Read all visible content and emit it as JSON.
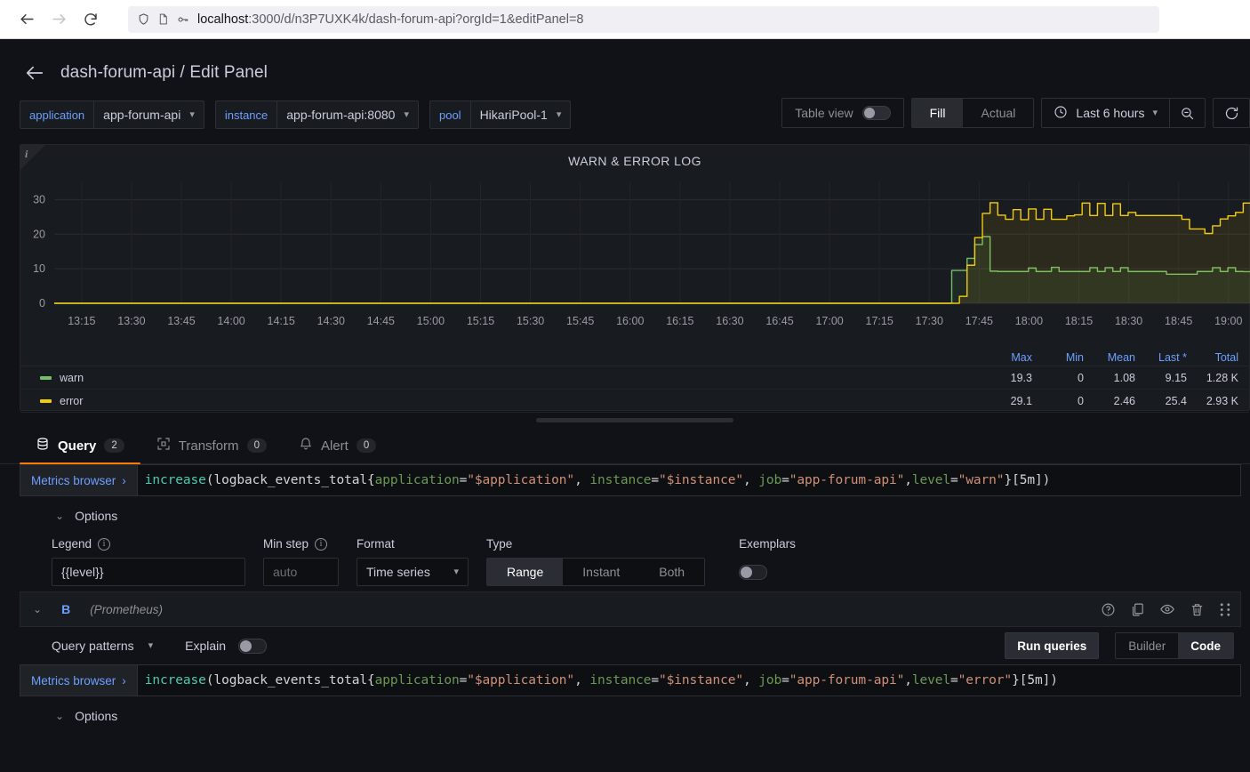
{
  "browser": {
    "url_host": "localhost",
    "url_rest": ":3000/d/n3P7UXK4k/dash-forum-api?orgId=1&editPanel=8",
    "back_icon": "back-arrow-icon",
    "forward_icon": "forward-arrow-icon",
    "reload_icon": "reload-icon",
    "shield_icon": "shield-icon",
    "page_icon": "page-icon",
    "key_icon": "key-icon"
  },
  "header": {
    "back_label": "back-arrow",
    "title": "dash-forum-api / Edit Panel"
  },
  "variables": [
    {
      "label": "application",
      "value": "app-forum-api"
    },
    {
      "label": "instance",
      "value": "app-forum-api:8080"
    },
    {
      "label": "pool",
      "value": "HikariPool-1"
    }
  ],
  "toolbar": {
    "table_view_label": "Table view",
    "table_view_on": false,
    "fill_label": "Fill",
    "actual_label": "Actual",
    "fill_active": true,
    "time_range": "Last 6 hours",
    "zoom_out_icon": "zoom-out-icon",
    "refresh_icon": "refresh-icon",
    "clock_icon": "clock-icon"
  },
  "panel": {
    "title": "WARN & ERROR LOG",
    "info_icon": "info-icon"
  },
  "chart_data": {
    "type": "line",
    "title": "WARN & ERROR LOG",
    "xlabel": "",
    "ylabel": "",
    "ylim": [
      0,
      35
    ],
    "yticks": [
      0,
      10,
      20,
      30
    ],
    "grid": true,
    "legend_position": "bottom-table",
    "xticks": [
      "13:15",
      "13:30",
      "13:45",
      "14:00",
      "14:15",
      "14:30",
      "14:45",
      "15:00",
      "15:15",
      "15:30",
      "15:45",
      "16:00",
      "16:15",
      "16:30",
      "16:45",
      "17:00",
      "17:15",
      "17:30",
      "17:45",
      "18:00",
      "18:15",
      "18:30",
      "18:45",
      "19:00"
    ],
    "series": [
      {
        "name": "warn",
        "color": "#73bf69",
        "values": [
          0,
          0,
          0,
          0,
          0,
          0,
          0,
          0,
          0,
          0,
          0,
          0,
          0,
          0,
          0,
          0,
          0,
          0,
          0,
          0,
          0,
          0,
          0,
          0,
          0,
          0,
          0,
          0,
          0,
          0,
          0,
          0,
          0,
          0,
          0,
          0,
          0,
          0,
          0,
          0,
          0,
          0,
          0,
          0,
          0,
          0,
          0,
          0,
          0,
          0,
          0,
          0,
          0,
          0,
          0,
          0,
          0,
          0,
          0,
          0,
          0,
          0,
          0,
          0,
          0,
          0,
          0,
          0,
          0,
          0,
          0,
          0,
          0,
          0,
          0,
          0,
          0,
          0,
          0,
          0,
          0,
          0,
          0,
          0,
          0,
          0,
          0,
          0,
          0,
          0,
          0,
          0,
          0,
          0,
          0,
          0,
          0,
          0,
          0,
          0,
          0,
          0,
          0,
          0,
          0,
          0,
          0,
          0,
          0,
          0,
          0,
          0,
          0,
          0,
          0,
          0,
          0,
          0,
          9.5,
          9.5,
          13,
          17,
          19.3,
          9.3,
          9.2,
          9.2,
          9.2,
          9.2,
          10.2,
          9.2,
          9.2,
          10.4,
          9.2,
          9.2,
          9.2,
          9.2,
          10.3,
          9.2,
          10.3,
          9.2,
          10.3,
          9.2,
          9.2,
          9.2,
          9.2,
          9.2,
          8.4,
          8.4,
          8.4,
          8.4,
          9.2,
          9.2,
          10.3,
          9.2,
          10.3,
          9.2,
          9.15
        ],
        "stats": {
          "max": "19.3",
          "min": "0",
          "mean": "1.08",
          "last": "9.15",
          "total": "1.28 K"
        }
      },
      {
        "name": "error",
        "color": "#f2cc0c",
        "values": [
          0,
          0,
          0,
          0,
          0,
          0,
          0,
          0,
          0,
          0,
          0,
          0,
          0,
          0,
          0,
          0,
          0,
          0,
          0,
          0,
          0,
          0,
          0,
          0,
          0,
          0,
          0,
          0,
          0,
          0,
          0,
          0,
          0,
          0,
          0,
          0,
          0,
          0,
          0,
          0,
          0,
          0,
          0,
          0,
          0,
          0,
          0,
          0,
          0,
          0,
          0,
          0,
          0,
          0,
          0,
          0,
          0,
          0,
          0,
          0,
          0,
          0,
          0,
          0,
          0,
          0,
          0,
          0,
          0,
          0,
          0,
          0,
          0,
          0,
          0,
          0,
          0,
          0,
          0,
          0,
          0,
          0,
          0,
          0,
          0,
          0,
          0,
          0,
          0,
          0,
          0,
          0,
          0,
          0,
          0,
          0,
          0,
          0,
          0,
          0,
          0,
          0,
          0,
          0,
          0,
          0,
          0,
          0,
          0,
          0,
          0,
          0,
          0,
          0,
          0,
          0,
          0,
          0,
          0,
          2,
          11,
          19,
          26,
          29.1,
          25.5,
          24.3,
          27.1,
          24.2,
          27.3,
          24.3,
          27.2,
          24.3,
          24.3,
          25.3,
          25.6,
          29,
          25.4,
          28.9,
          25.4,
          28.8,
          25.4,
          26.3,
          25.4,
          25.4,
          25.4,
          25.4,
          25.4,
          25.4,
          24.3,
          21.5,
          21.5,
          20.2,
          22.4,
          24.4,
          25.3,
          26.3,
          29,
          25.4,
          26.4,
          25.4,
          25.4
        ],
        "stats": {
          "max": "29.1",
          "min": "0",
          "mean": "2.46",
          "last": "25.4",
          "total": "2.93 K"
        }
      }
    ]
  },
  "legend": {
    "columns": [
      "Max",
      "Min",
      "Mean",
      "Last *",
      "Total"
    ]
  },
  "tabs": [
    {
      "label": "Query",
      "badge": "2",
      "icon": "database-icon",
      "active": true
    },
    {
      "label": "Transform",
      "badge": "0",
      "icon": "transform-icon",
      "active": false
    },
    {
      "label": "Alert",
      "badge": "0",
      "icon": "bell-icon",
      "active": false
    }
  ],
  "query_a": {
    "metrics_browser_label": "Metrics browser",
    "code_parts": {
      "fn": "increase",
      "p1": "(logback_events_total{",
      "l1": "application",
      "eq1": "=",
      "s1": "\"$application\"",
      "sep1": ", ",
      "l2": "instance",
      "eq2": "=",
      "s2": "\"$instance\"",
      "sep2": ", ",
      "l3": "job",
      "eq3": "=",
      "s3": "\"app-forum-api\"",
      "sep3": ",",
      "l4": "level",
      "eq4": "=",
      "s4": "\"warn\"",
      "tail": "}[5m])"
    },
    "options_label": "Options",
    "legend_label": "Legend",
    "legend_value": "{{level}}",
    "min_step_label": "Min step",
    "min_step_placeholder": "auto",
    "format_label": "Format",
    "format_value": "Time series",
    "type_label": "Type",
    "type_options": [
      "Range",
      "Instant",
      "Both"
    ],
    "type_selected": "Range",
    "exemplars_label": "Exemplars",
    "exemplars_on": false
  },
  "query_b": {
    "ref_id": "B",
    "datasource": "(Prometheus)",
    "icons": [
      "help-icon",
      "duplicate-icon",
      "eye-icon",
      "trash-icon",
      "drag-handle-icon"
    ],
    "query_patterns_label": "Query patterns",
    "explain_label": "Explain",
    "explain_on": false,
    "run_queries_label": "Run queries",
    "builder_label": "Builder",
    "code_label": "Code",
    "mode_selected": "Code",
    "metrics_browser_label": "Metrics browser",
    "code_parts": {
      "fn": "increase",
      "p1": "(logback_events_total{",
      "l1": "application",
      "eq1": "=",
      "s1": "\"$application\"",
      "sep1": ", ",
      "l2": "instance",
      "eq2": "=",
      "s2": "\"$instance\"",
      "sep2": ", ",
      "l3": "job",
      "eq3": "=",
      "s3": "\"app-forum-api\"",
      "sep3": ",",
      "l4": "level",
      "eq4": "=",
      "s4": "\"error\"",
      "tail": "}[5m])"
    },
    "options_label": "Options"
  }
}
